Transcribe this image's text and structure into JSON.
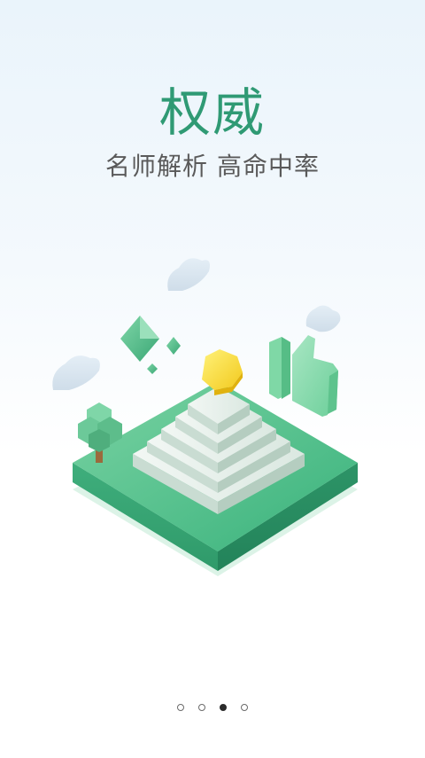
{
  "slide": {
    "title": "权威",
    "subtitle": "名师解析 高命中率"
  },
  "colors": {
    "accent": "#2f9a74",
    "subtitle": "#5a5a5a"
  },
  "pager": {
    "count": 4,
    "active_index": 2
  },
  "illustration": {
    "icons": [
      "pyramid-icon",
      "coin-icon",
      "thumbs-up-icon",
      "tree-icon",
      "diamond-icon",
      "cloud-icon"
    ]
  }
}
